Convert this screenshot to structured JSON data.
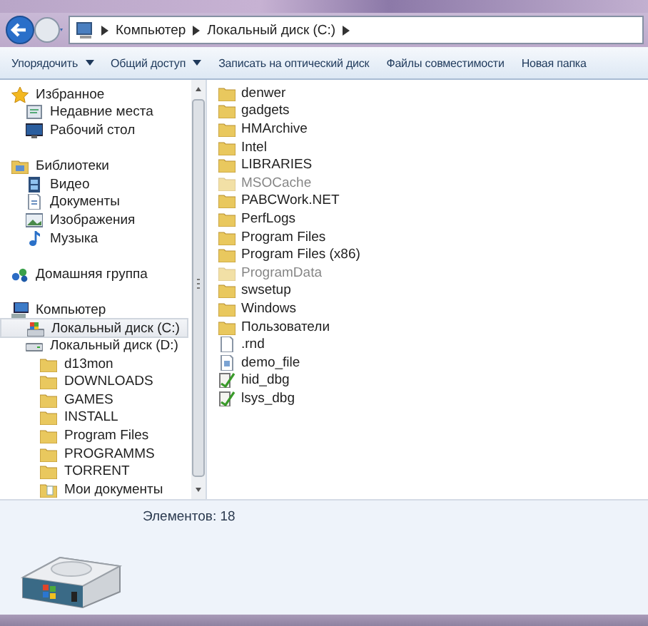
{
  "address_bar": {
    "path": [
      {
        "label": "Компьютер"
      },
      {
        "label": "Локальный диск (C:)"
      }
    ]
  },
  "toolbar": [
    {
      "label": "Упорядочить",
      "dropdown": true
    },
    {
      "label": "Общий доступ",
      "dropdown": true
    },
    {
      "label": "Записать на оптический диск",
      "dropdown": false
    },
    {
      "label": "Файлы совместимости",
      "dropdown": false
    },
    {
      "label": "Новая папка",
      "dropdown": false
    }
  ],
  "navigation_pane": [
    {
      "label": "Избранное",
      "kind": "favorites",
      "selected": false,
      "children": [
        {
          "label": "Недавние места",
          "kind": "recent",
          "selected": false
        },
        {
          "label": "Рабочий стол",
          "kind": "desktop",
          "selected": false
        }
      ]
    },
    {
      "label": "Библиотеки",
      "kind": "libraries",
      "selected": false,
      "children": [
        {
          "label": "Видео",
          "kind": "video",
          "selected": false
        },
        {
          "label": "Документы",
          "kind": "documents",
          "selected": false
        },
        {
          "label": "Изображения",
          "kind": "pictures",
          "selected": false
        },
        {
          "label": "Музыка",
          "kind": "music",
          "selected": false
        }
      ]
    },
    {
      "label": "Домашняя группа",
      "kind": "homegroup",
      "selected": false
    },
    {
      "label": "Компьютер",
      "kind": "computer",
      "selected": false,
      "children": [
        {
          "label": "Локальный диск (C:)",
          "kind": "system-drive",
          "selected": true
        },
        {
          "label": "Локальный диск (D:)",
          "kind": "drive",
          "selected": false,
          "children": [
            {
              "label": "d13mon",
              "kind": "folder",
              "selected": false
            },
            {
              "label": "DOWNLOADS",
              "kind": "folder",
              "selected": false
            },
            {
              "label": "GAMES",
              "kind": "folder",
              "selected": false
            },
            {
              "label": "INSTALL",
              "kind": "folder",
              "selected": false
            },
            {
              "label": "Program Files",
              "kind": "folder",
              "selected": false
            },
            {
              "label": "PROGRAMMS",
              "kind": "folder",
              "selected": false
            },
            {
              "label": "TORRENT",
              "kind": "folder",
              "selected": false
            },
            {
              "label": "Мои документы",
              "kind": "docfolder",
              "selected": false
            }
          ]
        }
      ]
    }
  ],
  "files": [
    {
      "name": "denwer",
      "kind": "folder",
      "hidden": false
    },
    {
      "name": "gadgets",
      "kind": "folder",
      "hidden": false
    },
    {
      "name": "HMArchive",
      "kind": "folder",
      "hidden": false
    },
    {
      "name": "Intel",
      "kind": "folder",
      "hidden": false
    },
    {
      "name": "LIBRARIES",
      "kind": "folder",
      "hidden": false
    },
    {
      "name": "MSOCache",
      "kind": "folder",
      "hidden": true
    },
    {
      "name": "PABCWork.NET",
      "kind": "folder",
      "hidden": false
    },
    {
      "name": "PerfLogs",
      "kind": "folder",
      "hidden": false
    },
    {
      "name": "Program Files",
      "kind": "folder",
      "hidden": false
    },
    {
      "name": "Program Files (x86)",
      "kind": "folder",
      "hidden": false
    },
    {
      "name": "ProgramData",
      "kind": "folder",
      "hidden": true
    },
    {
      "name": "swsetup",
      "kind": "folder",
      "hidden": false
    },
    {
      "name": "Windows",
      "kind": "folder",
      "hidden": false
    },
    {
      "name": "Пользователи",
      "kind": "folder",
      "hidden": false
    },
    {
      "name": ".rnd",
      "kind": "blank",
      "hidden": false
    },
    {
      "name": "demo_file",
      "kind": "document",
      "hidden": false
    },
    {
      "name": "hid_dbg",
      "kind": "script",
      "hidden": false
    },
    {
      "name": "lsys_dbg",
      "kind": "script",
      "hidden": false
    }
  ],
  "details_pane": {
    "item_count": "Элементов: 18"
  }
}
